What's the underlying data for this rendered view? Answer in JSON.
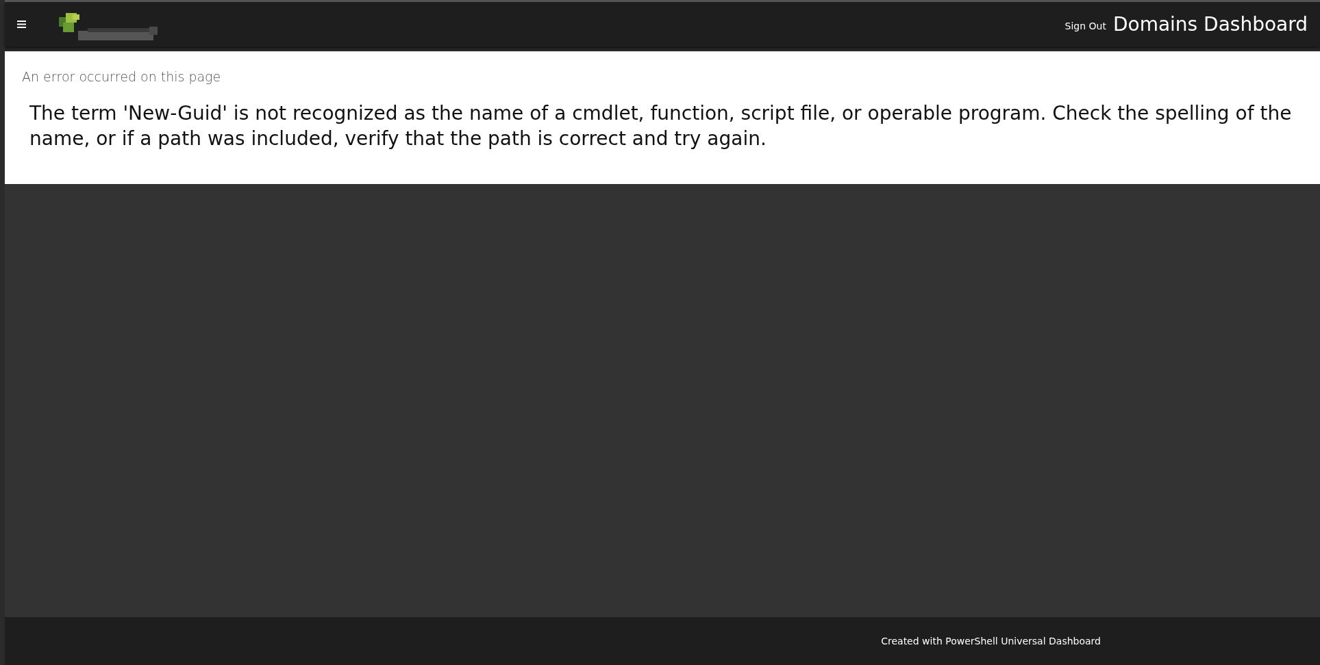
{
  "header": {
    "title": "Domains Dashboard",
    "sign_out": "Sign Out"
  },
  "error": {
    "heading": "An error occurred on this page",
    "message": "The term 'New-Guid' is not recognized as the name of a cmdlet, function, script file, or operable program. Check the spelling of the name, or if a path was included, verify that the path is correct and try again."
  },
  "footer": {
    "text": "Created with PowerShell Universal Dashboard"
  }
}
